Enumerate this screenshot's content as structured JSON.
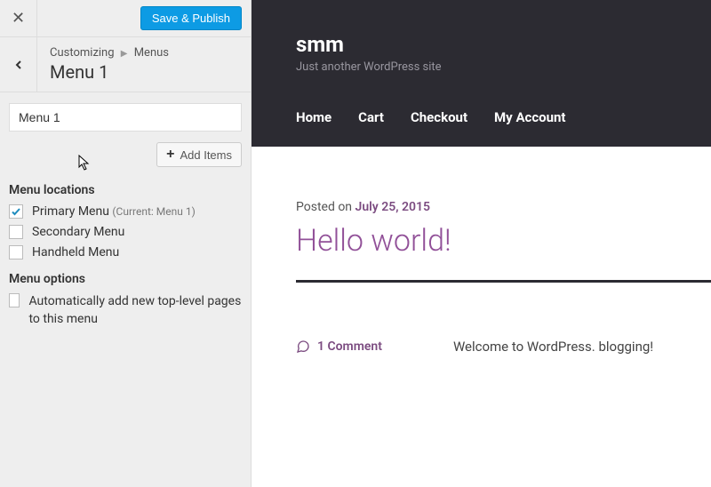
{
  "sidebar": {
    "save_label": "Save & Publish",
    "breadcrumb_root": "Customizing",
    "breadcrumb_section": "Menus",
    "panel_title": "Menu 1",
    "menu_name_value": "Menu 1",
    "add_items_label": "Add Items",
    "menu_locations_heading": "Menu locations",
    "locations": [
      {
        "label": "Primary Menu",
        "sub": "(Current: Menu 1)",
        "checked": true
      },
      {
        "label": "Secondary Menu",
        "sub": "",
        "checked": false
      },
      {
        "label": "Handheld Menu",
        "sub": "",
        "checked": false
      }
    ],
    "menu_options_heading": "Menu options",
    "auto_add_label": "Automatically add new top-level pages to this menu",
    "auto_add_checked": false
  },
  "preview": {
    "site_title": "smm",
    "site_tagline": "Just another WordPress site",
    "nav": [
      "Home",
      "Cart",
      "Checkout",
      "My Account"
    ],
    "posted_on_prefix": "Posted on ",
    "post_date": "July 25, 2015",
    "post_title": "Hello world!",
    "comment_count_label": "1 Comment",
    "excerpt": "Welcome to WordPress. blogging!"
  }
}
